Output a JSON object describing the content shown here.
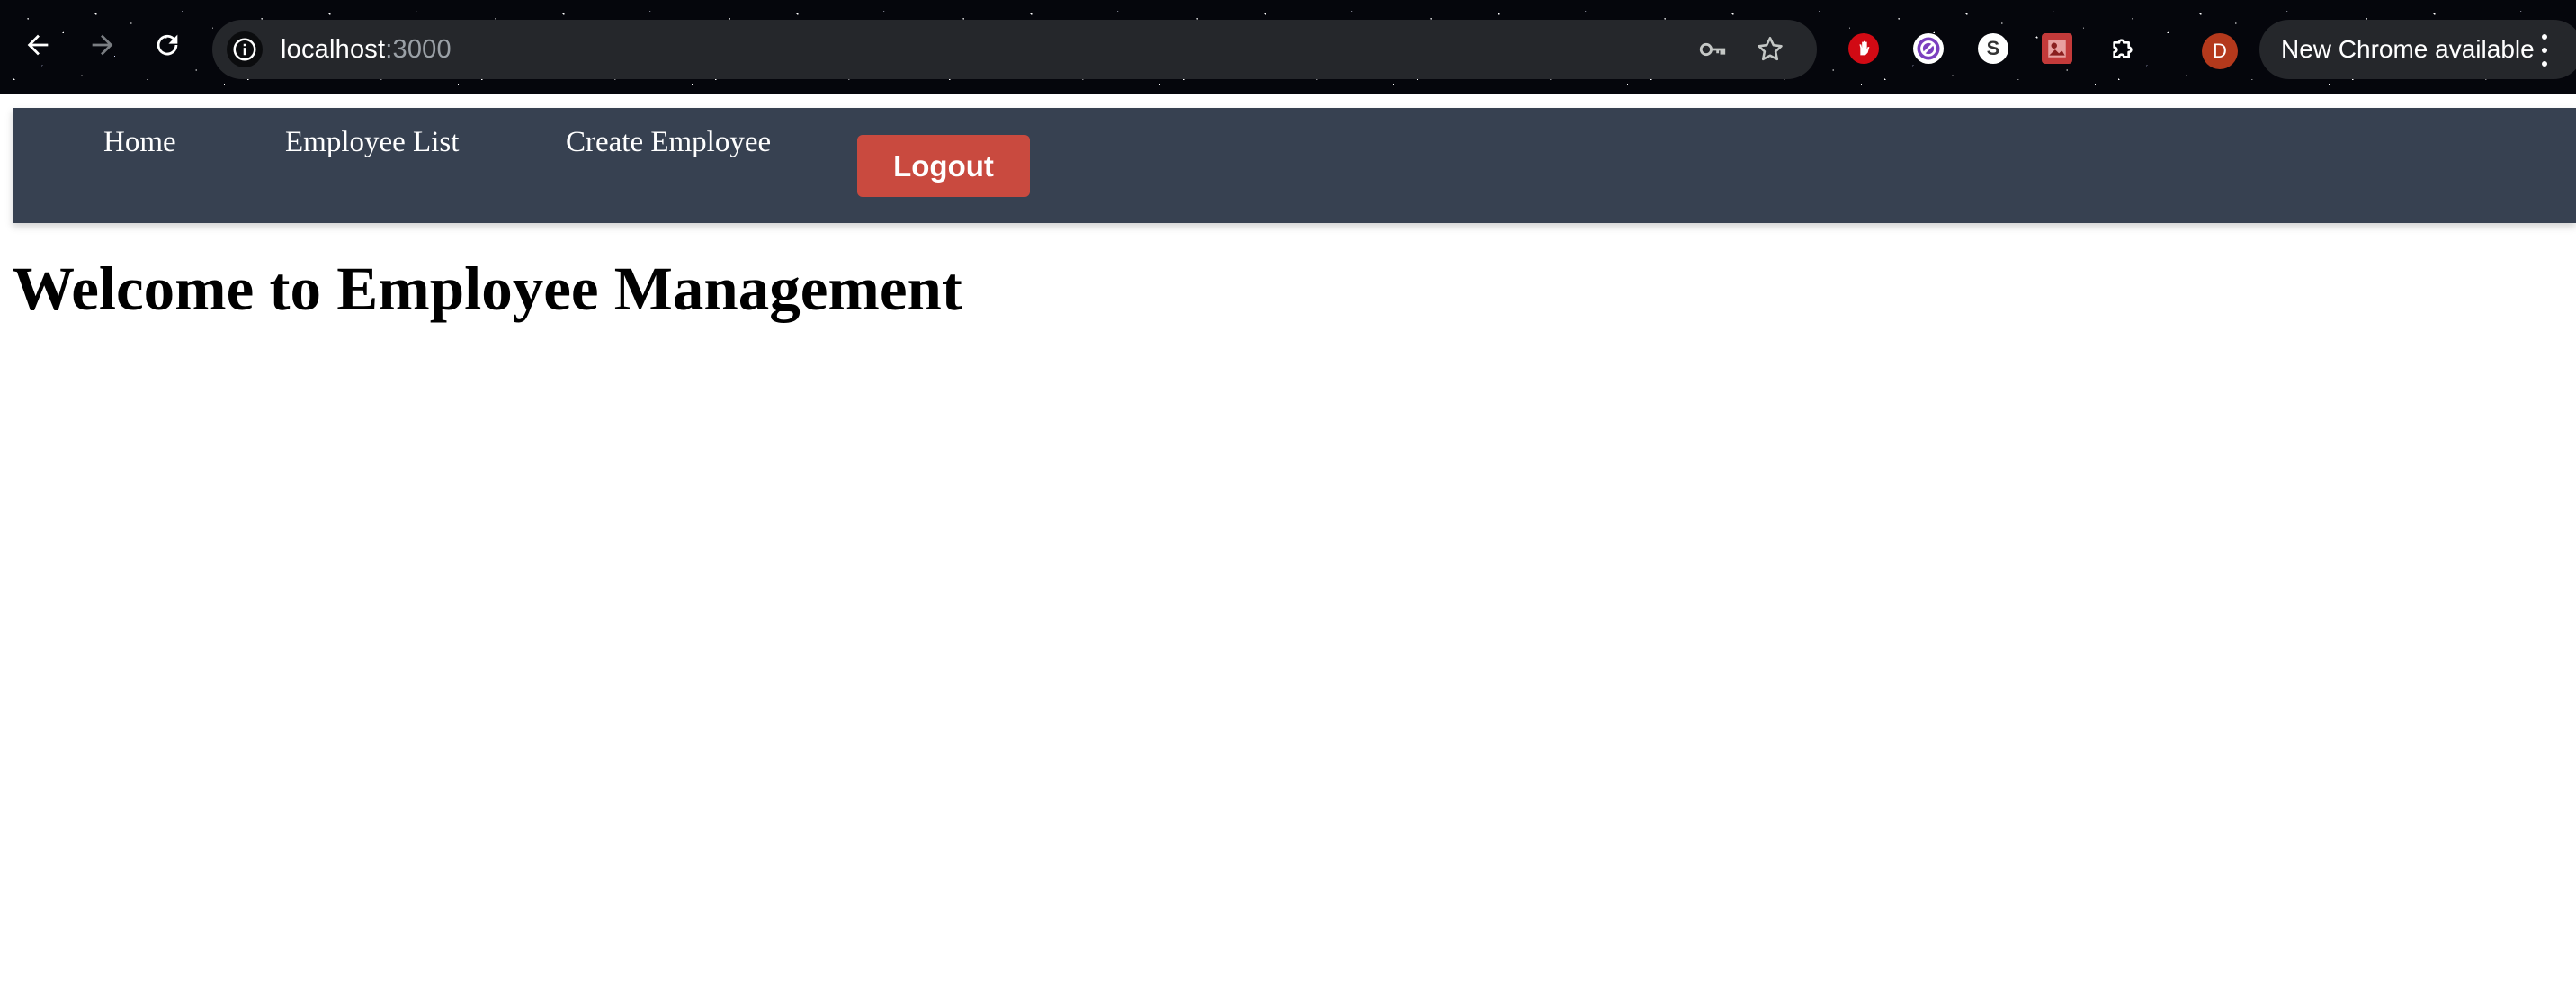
{
  "browser": {
    "url_host": "localhost",
    "url_port": ":3000",
    "update_label": "New Chrome available",
    "profile_initial": "D",
    "icons": {
      "back": "back-arrow-icon",
      "forward": "forward-arrow-icon",
      "reload": "reload-icon",
      "site_info": "info-icon",
      "passwords": "key-icon",
      "bookmark": "star-icon",
      "menu": "kebab-menu-icon"
    },
    "extensions": [
      {
        "name": "adblock-extension-icon",
        "color": "#d10a14"
      },
      {
        "name": "blocker-extension-icon",
        "color": "#7b3fbf"
      },
      {
        "name": "s-extension-icon",
        "color": "#ffffff",
        "glyph": "S"
      },
      {
        "name": "image-extension-icon",
        "color": "#c33a3a"
      },
      {
        "name": "extensions-puzzle-icon",
        "color": "#ffffff"
      }
    ]
  },
  "nav": {
    "home": "Home",
    "employee_list": "Employee List",
    "create_employee": "Create Employee",
    "logout": "Logout"
  },
  "main": {
    "title": "Welcome to Employee Management"
  },
  "colors": {
    "navbar": "#374151",
    "logout_button": "#c94a3f"
  }
}
